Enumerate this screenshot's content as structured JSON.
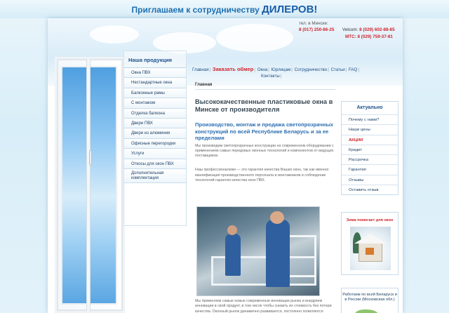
{
  "banner": {
    "text": "Приглашаем к сотрудничеству",
    "strong": "ДИЛЕРОВ!"
  },
  "contacts": {
    "city": "тел. в Минске:",
    "phone1": "8 (017) 250-86-25",
    "velcom_label": "Velcom:",
    "velcom": "8 (029) 602-88-85",
    "mts_label": "МТС:",
    "mts": "8 (029) 759-37-81"
  },
  "left_menu": {
    "head": "Наша продукция",
    "items": [
      "Окна ПВХ",
      "Нестандартные окна",
      "Балконные рамы",
      "С монтажом",
      "Отделка балкона",
      "Двери ПВХ",
      "Двери из алюминия",
      "Офисные перегородки",
      "Услуги",
      "Откосы для окон ПВХ",
      "Дополнительная комплектация"
    ]
  },
  "top_nav": {
    "items": [
      "Главная",
      "Заказать обмер",
      "Окна",
      "Юрлицам",
      "Сотрудничество",
      "Статьи",
      "FAQ",
      "Контакты"
    ]
  },
  "breadcrumb": "Главная",
  "content": {
    "h1": "Высококачественные пластиковые окна в Минске от производителя",
    "h2": "Производство, монтаж и продажа светопрозрачных конструкций по всей Республике Беларусь и за ее пределами",
    "p1": "Мы производим светопрозрачные конструкции на современном оборудовании с применением самых передовых оконных технологий и компонентов от ведущих поставщиков.",
    "p2": "Наш профессионализм — это гарантия качества Ваших окон, так как именно квалификация производственного персонала и монтажников и соблюдение технологий гарантия качества окон ПВХ.",
    "p3": "Мы применяем самые новые современные инновации рынка и внедряем инновации в свой продукт, в том числе чтобы снизить их стоимость без потери качества. Оконный рынок динамично развивается, постоянно появляются технические новинки, которые"
  },
  "right": {
    "actual_head": "Актуально",
    "items": [
      "Почему с нами?",
      "Наши цены",
      "АКЦИИ",
      "Кредит",
      "Рассрочка",
      "Гарантия",
      "Отзывы",
      "Оставить отзыв"
    ],
    "promo_title": "Зима помогает для окон",
    "map_text": "Работаем по всей Беларуси и в России (Московская обл.)"
  },
  "colors": {
    "accent": "#1f6fb0",
    "red": "#d0242c"
  }
}
